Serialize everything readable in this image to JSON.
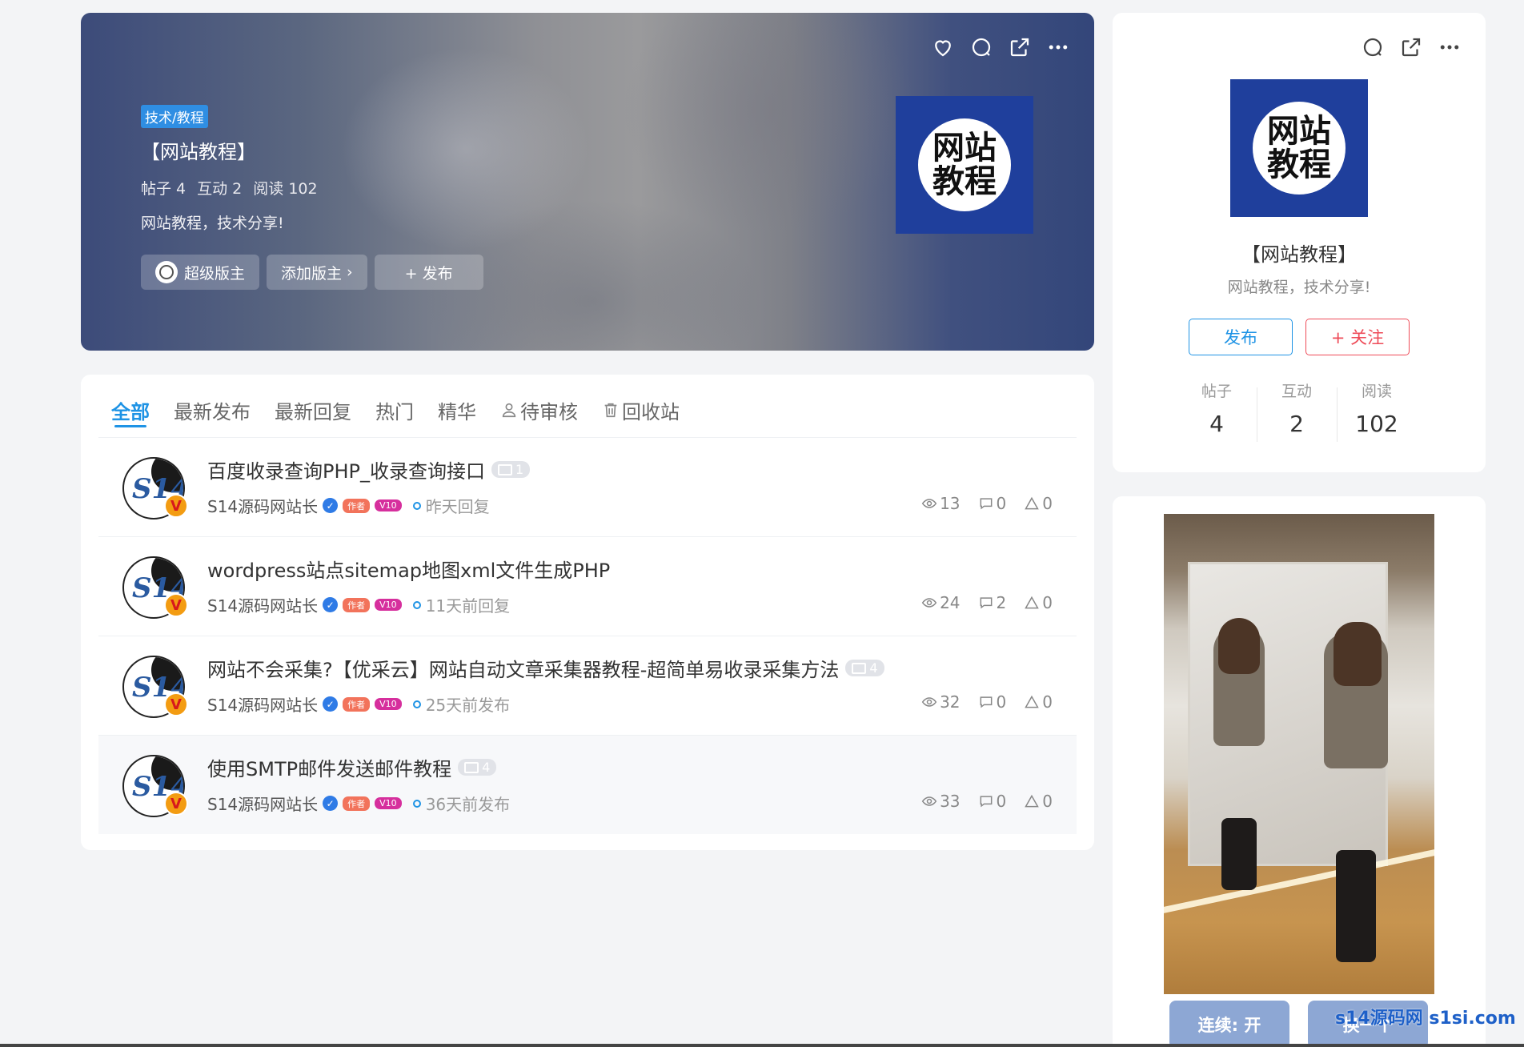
{
  "hero": {
    "category_tag": "技术/教程",
    "title": "【网站教程】",
    "stats": [
      "帖子 4",
      "互动 2",
      "阅读 102"
    ],
    "description": "网站教程，技术分享!",
    "buttons": {
      "moderator": "超级版主",
      "add_moderator": "添加版主",
      "publish": "+ 发布"
    },
    "logo_line1": "网站",
    "logo_line2": "教程"
  },
  "tabs": [
    {
      "label": "全部",
      "active": true
    },
    {
      "label": "最新发布"
    },
    {
      "label": "最新回复"
    },
    {
      "label": "热门"
    },
    {
      "label": "精华"
    },
    {
      "label": "待审核",
      "icon": "user-icon"
    },
    {
      "label": "回收站",
      "icon": "trash-icon"
    }
  ],
  "posts": [
    {
      "title": "百度收录查询PHP_收录查询接口",
      "img_count": "1",
      "author": "S14源码网站长",
      "badge_author": "作者",
      "badge_vip": "V10",
      "time": "昨天回复",
      "views": "13",
      "comments": "0",
      "likes": "0"
    },
    {
      "title": "wordpress站点sitemap地图xml文件生成PHP",
      "img_count": "",
      "author": "S14源码网站长",
      "badge_author": "作者",
      "badge_vip": "V10",
      "time": "11天前回复",
      "views": "24",
      "comments": "2",
      "likes": "0"
    },
    {
      "title": "网站不会采集?【优采云】网站自动文章采集器教程-超简单易收录采集方法",
      "img_count": "4",
      "author": "S14源码网站长",
      "badge_author": "作者",
      "badge_vip": "V10",
      "time": "25天前发布",
      "views": "32",
      "comments": "0",
      "likes": "0"
    },
    {
      "title": "使用SMTP邮件发送邮件教程",
      "img_count": "4",
      "author": "S14源码网站长",
      "badge_author": "作者",
      "badge_vip": "V10",
      "time": "36天前发布",
      "views": "33",
      "comments": "0",
      "likes": "0"
    }
  ],
  "sidebar": {
    "logo_line1": "网站",
    "logo_line2": "教程",
    "title": "【网站教程】",
    "description": "网站教程，技术分享!",
    "publish_label": "发布",
    "follow_label": "+ 关注",
    "stats": [
      {
        "label": "帖子",
        "value": "4"
      },
      {
        "label": "互动",
        "value": "2"
      },
      {
        "label": "阅读",
        "value": "102"
      }
    ]
  },
  "photo_card": {
    "continuous_label": "连续: 开",
    "next_label": "换一个"
  },
  "watermark": "s14源码网 s1si.com",
  "colors": {
    "accent": "#1e93e5",
    "follow": "#ee4b58",
    "logo_bg": "#1f3f9c"
  }
}
